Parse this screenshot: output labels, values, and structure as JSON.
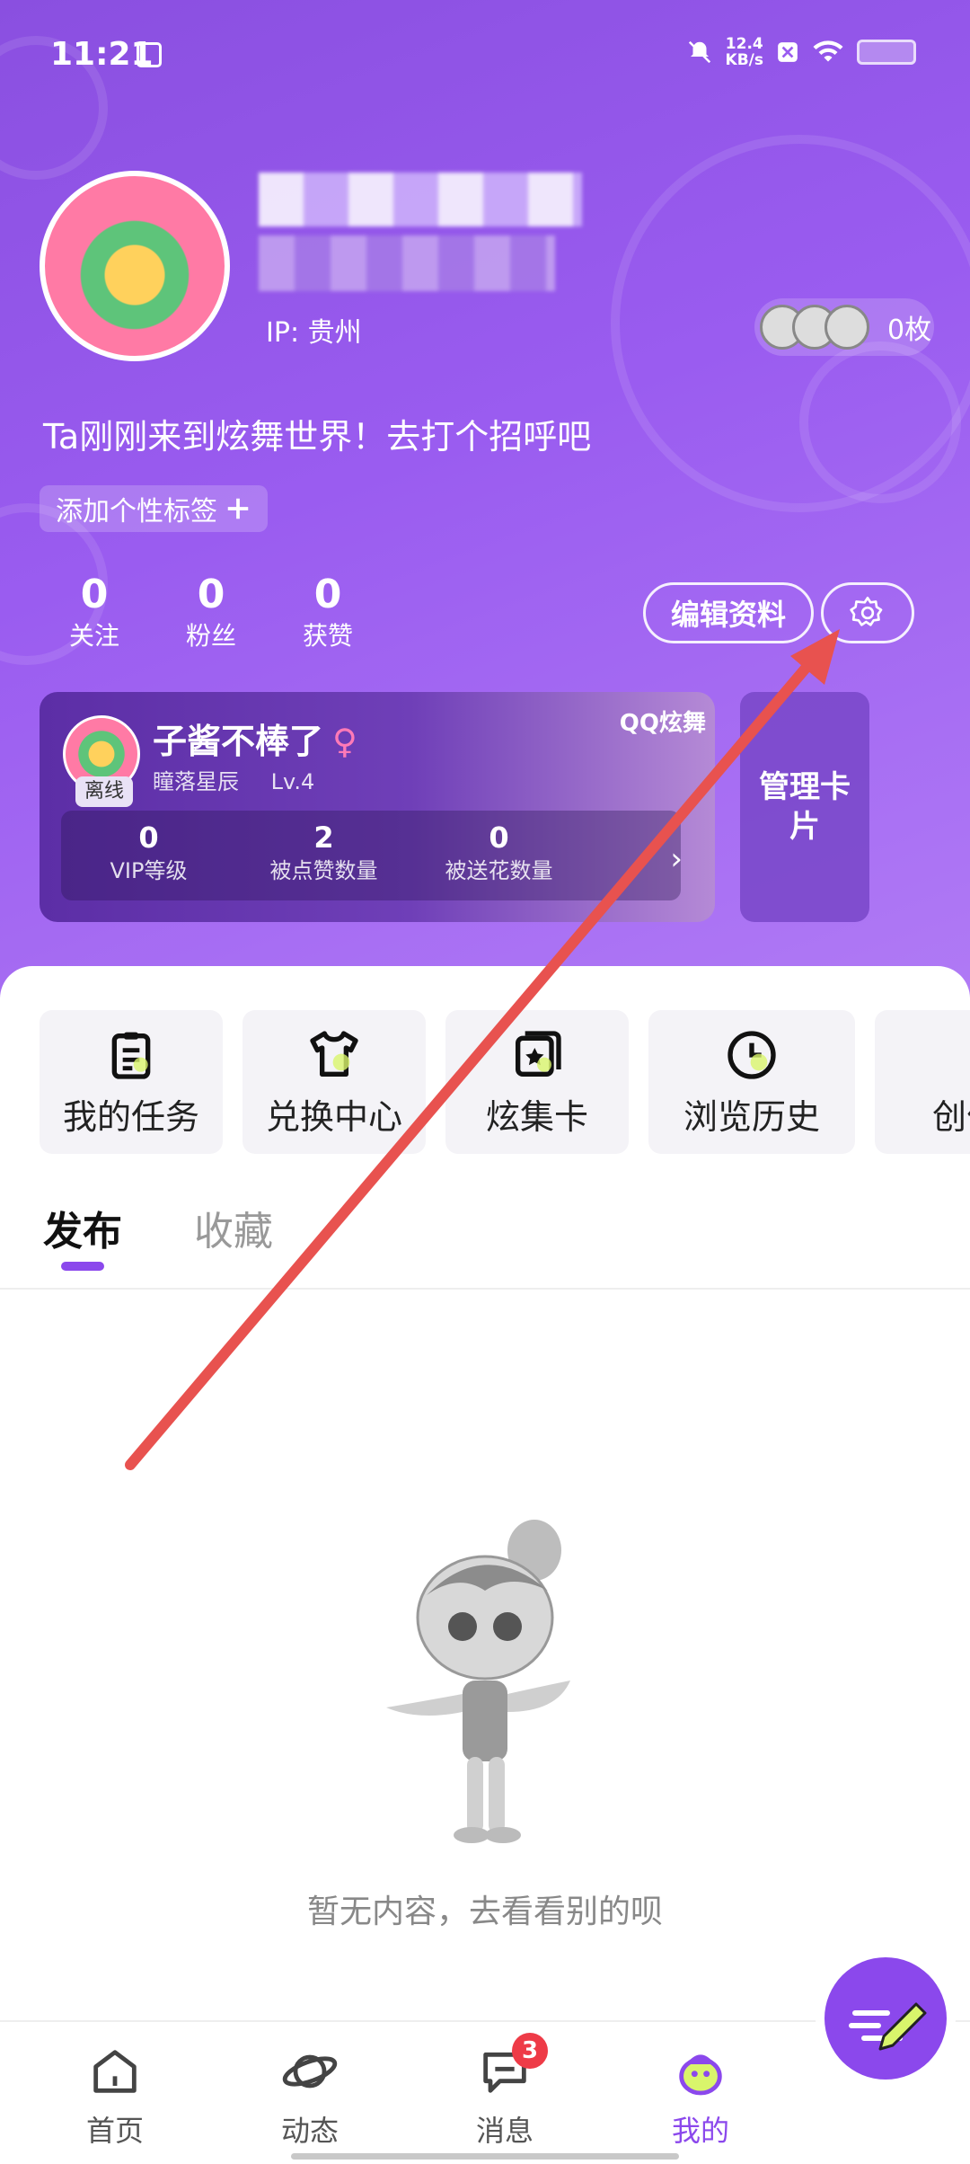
{
  "status_bar": {
    "time": "11:21",
    "net_speed_value": "12.4",
    "net_speed_unit": "KB/s"
  },
  "profile": {
    "ip_label": "IP: 贵州",
    "badge_count": "0枚",
    "bio": "Ta刚刚来到炫舞世界！去打个招呼吧",
    "add_tag": "添加个性标签",
    "stats": [
      {
        "value": "0",
        "label": "关注"
      },
      {
        "value": "0",
        "label": "粉丝"
      },
      {
        "value": "0",
        "label": "获赞"
      }
    ],
    "edit_profile": "编辑资料"
  },
  "game_card": {
    "nickname": "子酱不棒了",
    "gender_symbol": "♀",
    "server": "瞳落星辰",
    "level": "Lv.4",
    "status": "离线",
    "logo_text": "QQ炫舞",
    "stats": [
      {
        "value": "0",
        "label": "VIP等级"
      },
      {
        "value": "2",
        "label": "被点赞数量"
      },
      {
        "value": "0",
        "label": "被送花数量"
      }
    ],
    "manage_label": "管理卡片"
  },
  "shortcuts": [
    {
      "label": "我的任务",
      "icon": "clipboard-icon"
    },
    {
      "label": "兑换中心",
      "icon": "shirt-icon"
    },
    {
      "label": "炫集卡",
      "icon": "card-icon"
    },
    {
      "label": "浏览历史",
      "icon": "clock-icon"
    },
    {
      "label": "创作",
      "icon": "create-icon"
    }
  ],
  "tabs": [
    {
      "label": "发布"
    },
    {
      "label": "收藏"
    }
  ],
  "empty_state": {
    "text": "暂无内容，去看看别的呗"
  },
  "bottom_nav": [
    {
      "label": "首页",
      "icon": "home-icon"
    },
    {
      "label": "动态",
      "icon": "planet-icon"
    },
    {
      "label": "消息",
      "icon": "message-icon",
      "badge": "3"
    },
    {
      "label": "我的",
      "icon": "profile-mascot-icon"
    }
  ],
  "colors": {
    "accent": "#8b48ec",
    "hero_top": "#8a4fe0",
    "hero_bottom": "#b07af5",
    "badge_red": "#ee3b47",
    "annotation_arrow": "#e8524f"
  }
}
